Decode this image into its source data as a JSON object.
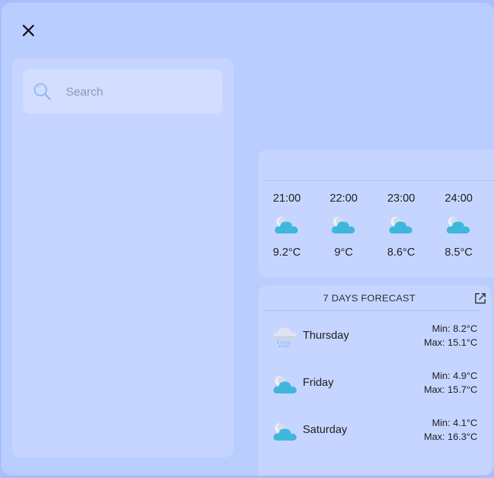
{
  "search": {
    "placeholder": "Search",
    "value": ""
  },
  "hourly": [
    {
      "time": "21:00",
      "icon": "cloud-moon-icon",
      "temp": "9.2°C"
    },
    {
      "time": "22:00",
      "icon": "cloud-moon-icon",
      "temp": "9°C"
    },
    {
      "time": "23:00",
      "icon": "cloud-moon-icon",
      "temp": "8.6°C"
    },
    {
      "time": "24:00",
      "icon": "cloud-moon-icon",
      "temp": "8.5°C"
    }
  ],
  "forecast": {
    "title": "7 DAYS FORECAST",
    "days": [
      {
        "name": "Thursday",
        "icon": "rain-cloud-icon",
        "min": "Min: 8.2°C",
        "max": "Max: 15.1°C"
      },
      {
        "name": "Friday",
        "icon": "cloud-moon-icon",
        "min": "Min: 4.9°C",
        "max": "Max: 15.7°C"
      },
      {
        "name": "Saturday",
        "icon": "cloud-moon-icon",
        "min": "Min: 4.1°C",
        "max": "Max: 16.3°C"
      }
    ]
  },
  "colors": {
    "background": "#bacdff",
    "panel": "#c6d5ff",
    "cloud": "#3fb7dd",
    "rain_cloud": "#dfe4f0"
  }
}
